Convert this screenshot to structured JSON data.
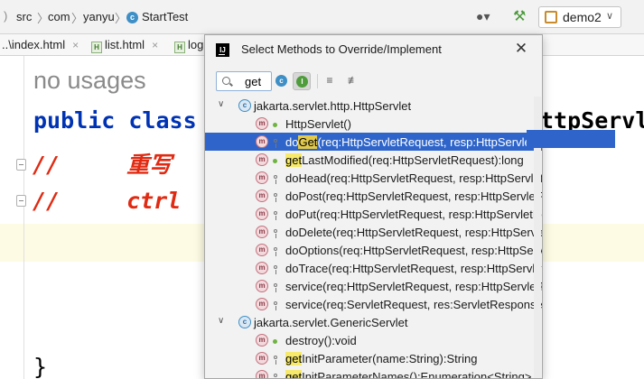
{
  "navbar": {
    "breadcrumbs": [
      "src",
      "com",
      "yanyu",
      "StartTest"
    ],
    "run_config": "demo2"
  },
  "tabs": [
    "..\\index.html",
    "list.html",
    "log"
  ],
  "editor": {
    "usages_hint": "no usages",
    "line_class_keywords": "public class",
    "line_class_tail": "ttpServle",
    "comment1_slashes": "//",
    "comment1_text": "重写",
    "comment2_slashes": "//",
    "comment2_text": "ctrl",
    "closing_brace": "}"
  },
  "dialog": {
    "title": "Select Methods to Override/Implement",
    "search_value": "get",
    "groups": [
      {
        "label": "jakarta.servlet.http.HttpServlet",
        "methods": [
          {
            "pre": "",
            "hl": "",
            "post": "HttpServlet()"
          },
          {
            "pre": "do",
            "hl": "Get",
            "post": "(req:HttpServletRequest, resp:HttpServletResponse):void",
            "selected": true
          },
          {
            "pre": "",
            "hl": "get",
            "post": "LastModified(req:HttpServletRequest):long"
          },
          {
            "pre": "",
            "hl": "",
            "post": "doHead(req:HttpServletRequest, resp:HttpServletResponse):void"
          },
          {
            "pre": "",
            "hl": "",
            "post": "doPost(req:HttpServletRequest, resp:HttpServletResponse):void"
          },
          {
            "pre": "",
            "hl": "",
            "post": "doPut(req:HttpServletRequest, resp:HttpServletResponse):void"
          },
          {
            "pre": "",
            "hl": "",
            "post": "doDelete(req:HttpServletRequest, resp:HttpServletResponse):void"
          },
          {
            "pre": "",
            "hl": "",
            "post": "doOptions(req:HttpServletRequest, resp:HttpServletResponse):void"
          },
          {
            "pre": "",
            "hl": "",
            "post": "doTrace(req:HttpServletRequest, resp:HttpServletResponse):void"
          },
          {
            "pre": "",
            "hl": "",
            "post": "service(req:HttpServletRequest, resp:HttpServletResponse):void"
          },
          {
            "pre": "",
            "hl": "",
            "post": "service(req:ServletRequest, res:ServletResponse):void"
          }
        ]
      },
      {
        "label": "jakarta.servlet.GenericServlet",
        "methods": [
          {
            "pre": "",
            "hl": "",
            "post": "destroy():void"
          },
          {
            "pre": "",
            "hl": "get",
            "post": "InitParameter(name:String):String"
          },
          {
            "pre": "",
            "hl": "get",
            "post": "InitParameterNames():Enumeration<String>"
          }
        ]
      }
    ]
  },
  "icons": {
    "class": "class-icon",
    "method": "method-icon",
    "public": "public-visibility-icon",
    "protected": "protected-visibility-icon"
  },
  "colors": {
    "selection": "#2f65ca",
    "search_highlight": "#f6e96b",
    "keyword": "#0033b3",
    "comment": "#e02a12"
  }
}
